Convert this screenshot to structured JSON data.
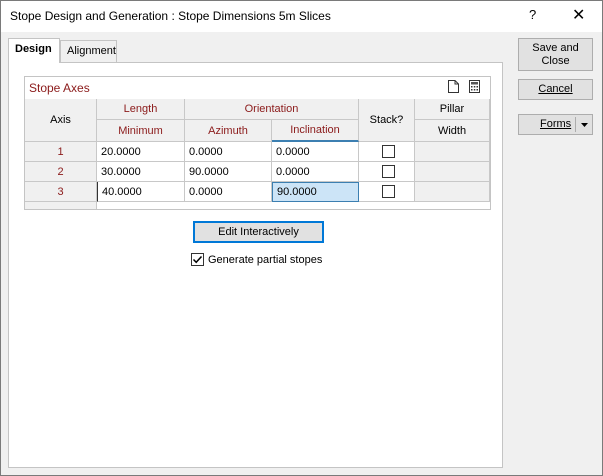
{
  "window": {
    "title": "Stope Design and Generation : Stope Dimensions 5m Slices",
    "help_label": "?",
    "close_label": "✕"
  },
  "tabs": [
    {
      "label": "Design",
      "active": true
    },
    {
      "label": "Alignment",
      "active": false
    }
  ],
  "stope_axes": {
    "title": "Stope Axes",
    "icons": [
      "new-document-icon",
      "calculator-icon"
    ],
    "headers": {
      "axis": "Axis",
      "length": "Length",
      "minimum": "Minimum",
      "orientation": "Orientation",
      "azimuth": "Azimuth",
      "inclination": "Inclination",
      "stack": "Stack?",
      "pillar": "Pillar",
      "width": "Width"
    },
    "rows": [
      {
        "axis": "1",
        "minimum": "20.0000",
        "azimuth": "0.0000",
        "inclination": "0.0000",
        "stack": false,
        "pillar_width": ""
      },
      {
        "axis": "2",
        "minimum": "30.0000",
        "azimuth": "90.0000",
        "inclination": "0.0000",
        "stack": false,
        "pillar_width": ""
      },
      {
        "axis": "3",
        "minimum": "40.0000",
        "azimuth": "0.0000",
        "inclination": "90.0000",
        "stack": false,
        "pillar_width": ""
      }
    ]
  },
  "edit_interactively_label": "Edit Interactively",
  "generate_partial": {
    "label": "Generate partial stopes",
    "checked": true
  },
  "side_buttons": {
    "save_close": "Save and Close",
    "cancel": "Cancel",
    "forms": "Forms"
  },
  "colors": {
    "header_red": "#8b1a1a",
    "selection": "#cce4f7",
    "focus_blue": "#0078d7"
  }
}
